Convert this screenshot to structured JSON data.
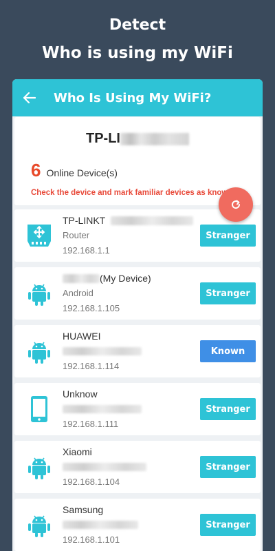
{
  "promo": {
    "line1": "Detect",
    "line2": "Who is using my WiFi"
  },
  "appbar": {
    "title": "Who Is Using My WiFi?",
    "back_icon": "arrow-left-icon"
  },
  "network": {
    "ssid_visible": "TP-LI",
    "online_count": "6",
    "online_label": "Online Device(s)",
    "hint": "Check the device and mark familiar devices as known"
  },
  "refresh_icon": "refresh-icon",
  "colors": {
    "accent": "#2ec3d6",
    "known": "#3f8fe6",
    "alert": "#e84a2a",
    "fab": "#f06b5f",
    "background": "#3a4a5c"
  },
  "devices": [
    {
      "name": "TP-LINKT",
      "type": "Router",
      "ip": "192.168.1.1",
      "status": "Stranger",
      "icon": "router-icon"
    },
    {
      "name": "(My Device)",
      "type": "Android",
      "ip": "192.168.1.105",
      "status": "Stranger",
      "icon": "android-icon"
    },
    {
      "name": "HUAWEI",
      "type": "",
      "ip": "192.168.1.114",
      "status": "Known",
      "icon": "android-icon"
    },
    {
      "name": "Unknow",
      "type": "",
      "ip": "192.168.1.111",
      "status": "Stranger",
      "icon": "phone-icon"
    },
    {
      "name": "Xiaomi",
      "type": "",
      "ip": "192.168.1.104",
      "status": "Stranger",
      "icon": "android-icon"
    },
    {
      "name": "Samsung",
      "type": "",
      "ip": "192.168.1.101",
      "status": "Stranger",
      "icon": "android-icon"
    }
  ]
}
